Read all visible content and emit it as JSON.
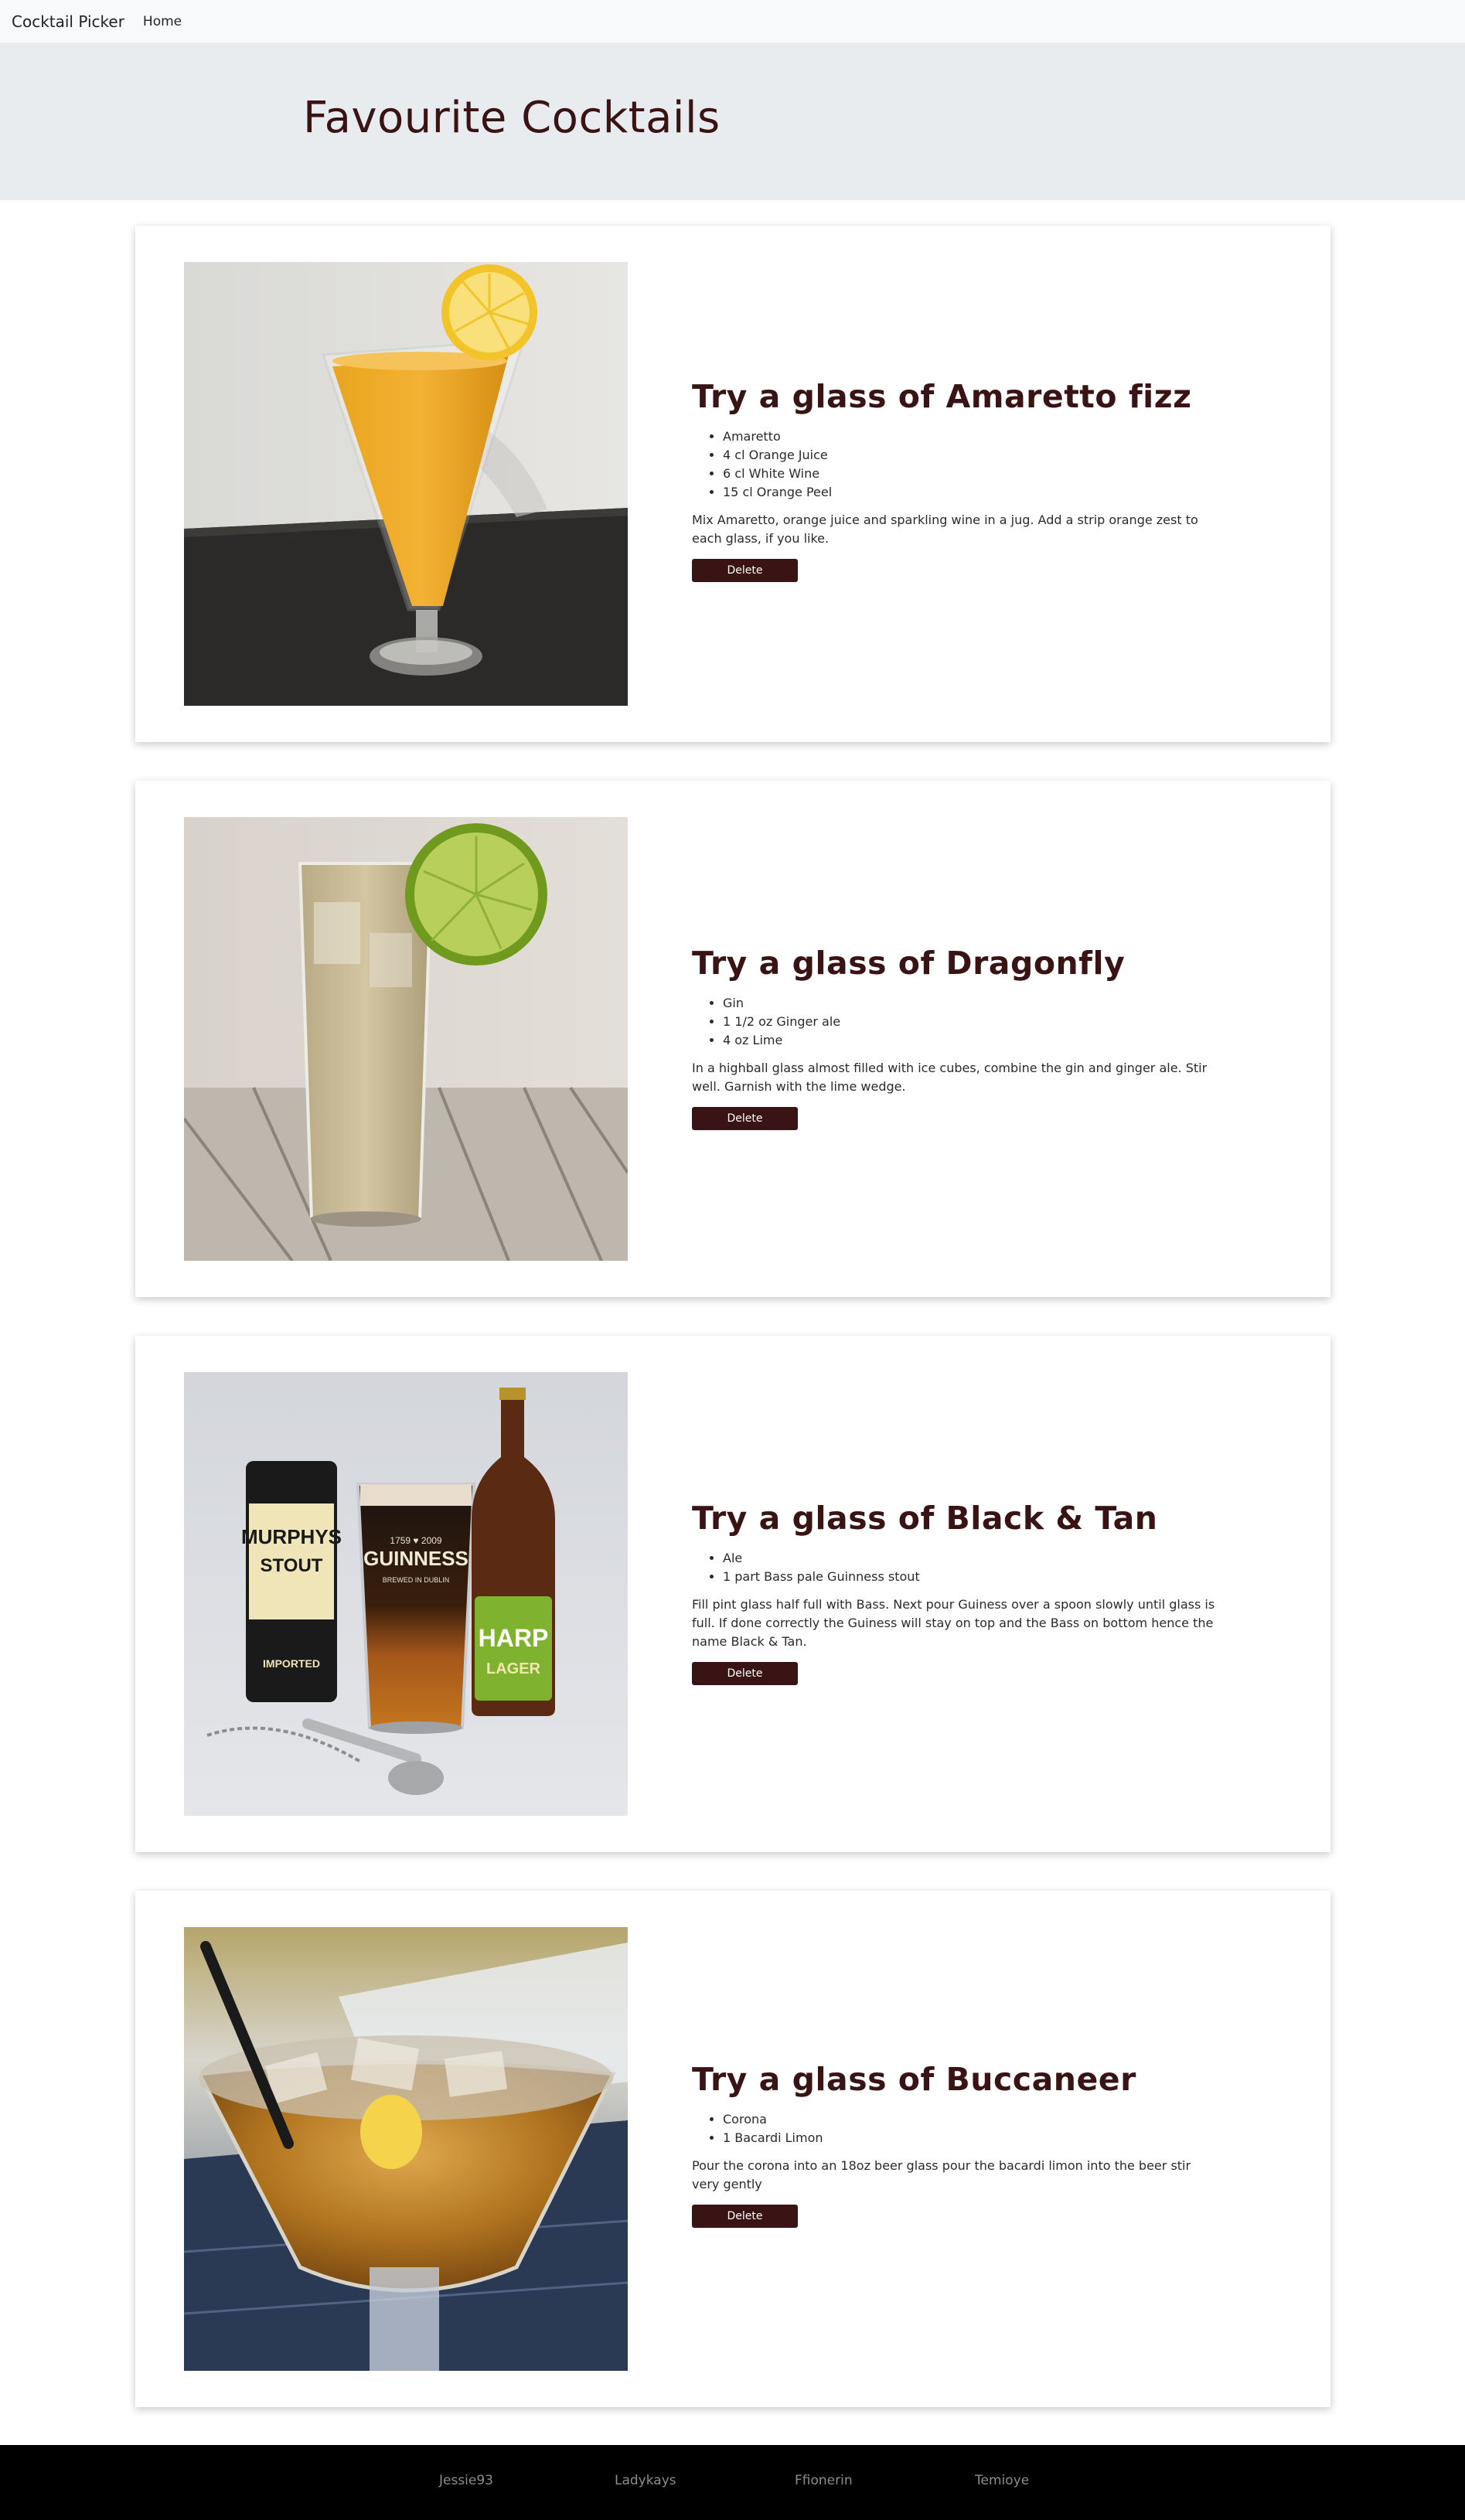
{
  "navbar": {
    "brand": "Cocktail Picker",
    "home_link": "Home"
  },
  "hero": {
    "title": "Favourite Cocktails"
  },
  "colors": {
    "accent": "#3a1414",
    "hero_bg": "#e9ecef",
    "navbar_bg": "#f8f9fa",
    "footer_bg": "#000000"
  },
  "cocktails": [
    {
      "title": "Try a glass of Amaretto fizz",
      "ingredients": [
        "Amaretto",
        "4 cl Orange Juice",
        "6 cl White Wine",
        "15 cl Orange Peel"
      ],
      "method": "Mix Amaretto, orange juice and sparkling wine in a jug. Add a strip orange zest to each glass, if you like.",
      "delete_label": "Delete",
      "image": "amaretto-fizz-photo"
    },
    {
      "title": "Try a glass of Dragonfly",
      "ingredients": [
        "Gin",
        "1 1/2 oz Ginger ale",
        "4 oz Lime"
      ],
      "method": "In a highball glass almost filled with ice cubes, combine the gin and ginger ale. Stir well. Garnish with the lime wedge.",
      "delete_label": "Delete",
      "image": "dragonfly-photo"
    },
    {
      "title": "Try a glass of Black & Tan",
      "ingredients": [
        "Ale",
        "1 part Bass pale Guinness stout"
      ],
      "method": "Fill pint glass half full with Bass. Next pour Guiness over a spoon slowly until glass is full. If done correctly the Guiness will stay on top and the Bass on bottom hence the name Black & Tan.",
      "delete_label": "Delete",
      "image": "black-and-tan-photo",
      "labels": {
        "can_brand": "MURPHYS",
        "can_sub": "STOUT",
        "can_note": "IMPORTED",
        "glass_year": "1759 ♥ 2009",
        "glass_brand": "GUINNESS",
        "glass_note": "BREWED IN DUBLIN",
        "bottle_brand": "HARP",
        "bottle_sub": "LAGER"
      }
    },
    {
      "title": "Try a glass of Buccaneer",
      "ingredients": [
        "Corona",
        "1 Bacardi Limon"
      ],
      "method": "Pour the corona into an 18oz beer glass pour the bacardi limon into the beer stir very gently",
      "delete_label": "Delete",
      "image": "buccaneer-photo"
    }
  ],
  "footer": {
    "links": [
      "Jessie93",
      "Ladykays",
      "Ffionerin",
      "Temioye"
    ]
  }
}
